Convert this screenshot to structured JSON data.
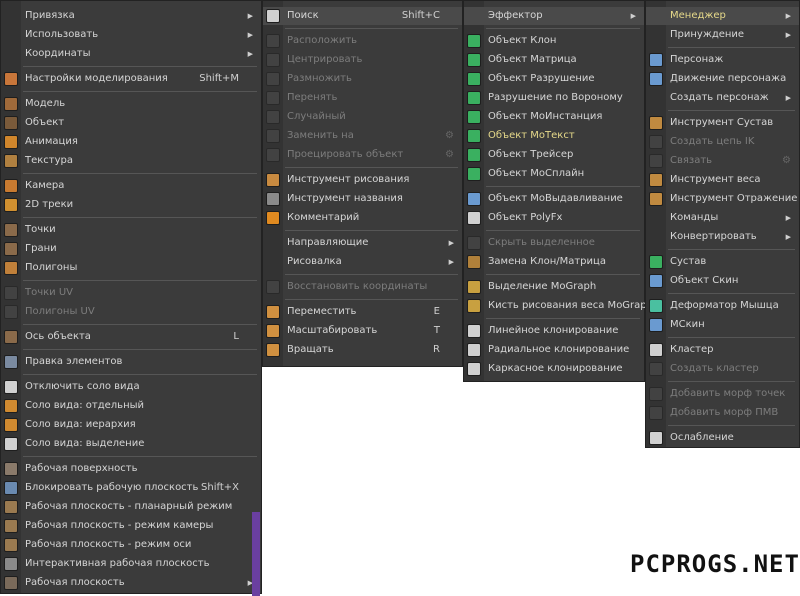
{
  "menus": {
    "main": [
      {
        "label": "Привязка",
        "arrow": true,
        "icon": "empty"
      },
      {
        "label": "Использовать",
        "arrow": true,
        "icon": "empty"
      },
      {
        "label": "Координаты",
        "arrow": true,
        "icon": "empty"
      },
      {
        "sep": true
      },
      {
        "label": "Настройки моделирования",
        "shortcut": "Shift+M",
        "icon": "modeling-settings-icon",
        "color": "#c8763a"
      },
      {
        "sep": true
      },
      {
        "label": "Модель",
        "icon": "model-icon",
        "color": "#a06a3a"
      },
      {
        "label": "Объект",
        "icon": "object-icon",
        "color": "#7a5a3a"
      },
      {
        "label": "Анимация",
        "icon": "animation-icon",
        "color": "#d0862c"
      },
      {
        "label": "Текстура",
        "icon": "texture-icon",
        "color": "#b08040"
      },
      {
        "sep": true
      },
      {
        "label": "Камера",
        "icon": "camera-icon",
        "color": "#c87a30"
      },
      {
        "label": "2D треки",
        "icon": "2d-tracks-icon",
        "color": "#d09030"
      },
      {
        "sep": true
      },
      {
        "label": "Точки",
        "icon": "points-icon",
        "color": "#8a6a4a"
      },
      {
        "label": "Грани",
        "icon": "edges-icon",
        "color": "#8a6a4a"
      },
      {
        "label": "Полигоны",
        "icon": "polygons-icon",
        "color": "#c0803a"
      },
      {
        "sep": true
      },
      {
        "label": "Точки UV",
        "disabled": true,
        "icon": "uv-points-icon",
        "color": "#555"
      },
      {
        "label": "Полигоны UV",
        "disabled": true,
        "icon": "uv-polygons-icon",
        "color": "#555"
      },
      {
        "sep": true
      },
      {
        "label": "Ось объекта",
        "shortcut": "L",
        "icon": "object-axis-icon",
        "color": "#8a6a4a"
      },
      {
        "sep": true
      },
      {
        "label": "Правка элементов",
        "icon": "edit-elements-icon",
        "color": "#7a8aa0"
      },
      {
        "sep": true
      },
      {
        "label": "Отключить соло вида",
        "icon": "solo-off-icon",
        "color": "#d0d0d0"
      },
      {
        "label": "Соло вида: отдельный",
        "icon": "solo-single-icon",
        "color": "#d08a30"
      },
      {
        "label": "Соло вида: иерархия",
        "icon": "solo-hierarchy-icon",
        "color": "#d08a30"
      },
      {
        "label": "Соло вида: выделение",
        "icon": "solo-selection-icon",
        "color": "#d0d0d0"
      },
      {
        "sep": true
      },
      {
        "label": "Рабочая поверхность",
        "icon": "workplane-icon",
        "color": "#8a7a6a"
      },
      {
        "label": "Блокировать рабочую плоскость",
        "shortcut": "Shift+X",
        "icon": "lock-workplane-icon",
        "color": "#6a8ab0"
      },
      {
        "label": "Рабочая плоскость - планарный режим",
        "icon": "workplane-planar-icon",
        "color": "#9a7a50"
      },
      {
        "label": "Рабочая плоскость - режим камеры",
        "icon": "workplane-camera-icon",
        "color": "#9a7a50"
      },
      {
        "label": "Рабочая плоскость - режим оси",
        "icon": "workplane-axis-icon",
        "color": "#9a7a50"
      },
      {
        "label": "Интерактивная рабочая плоскость",
        "icon": "interactive-workplane-icon",
        "color": "#8a8a8a"
      },
      {
        "label": "Рабочая плоскость",
        "arrow": true,
        "icon": "workplane-sub-icon",
        "color": "#7a6a5a"
      }
    ],
    "second": [
      {
        "label": "Поиск",
        "shortcut": "Shift+C",
        "icon": "search-icon",
        "color": "#d0d0d0",
        "highlight": true
      },
      {
        "sep": true
      },
      {
        "label": "Расположить",
        "disabled": true,
        "icon": "arrange-icon",
        "color": "#555"
      },
      {
        "label": "Центрировать",
        "disabled": true,
        "icon": "center-icon",
        "color": "#555"
      },
      {
        "label": "Размножить",
        "disabled": true,
        "icon": "duplicate-icon",
        "color": "#555"
      },
      {
        "label": "Перенять",
        "disabled": true,
        "icon": "transfer-icon",
        "color": "#555"
      },
      {
        "label": "Случайный",
        "disabled": true,
        "icon": "randomize-icon",
        "color": "#555"
      },
      {
        "label": "Заменить на",
        "disabled": true,
        "icon": "replace-icon",
        "color": "#555",
        "gear": true
      },
      {
        "label": "Проецировать объект",
        "disabled": true,
        "icon": "project-icon",
        "color": "#555",
        "gear": true
      },
      {
        "sep": true
      },
      {
        "label": "Инструмент рисования",
        "icon": "paint-tool-icon",
        "color": "#c88a40"
      },
      {
        "label": "Инструмент названия",
        "icon": "naming-tool-icon",
        "color": "#8a8a8a"
      },
      {
        "label": "Комментарий",
        "icon": "comment-icon",
        "color": "#e08a20"
      },
      {
        "sep": true
      },
      {
        "label": "Направляющие",
        "arrow": true,
        "icon": "empty"
      },
      {
        "label": "Рисовалка",
        "arrow": true,
        "icon": "empty"
      },
      {
        "sep": true
      },
      {
        "label": "Восстановить координаты",
        "disabled": true,
        "icon": "reset-coords-icon",
        "color": "#555"
      },
      {
        "sep": true
      },
      {
        "label": "Переместить",
        "shortcut": "E",
        "icon": "move-icon",
        "color": "#d09040"
      },
      {
        "label": "Масштабировать",
        "shortcut": "T",
        "icon": "scale-icon",
        "color": "#d09040"
      },
      {
        "label": "Вращать",
        "shortcut": "R",
        "icon": "rotate-icon",
        "color": "#d09040"
      }
    ],
    "third": [
      {
        "label": "Эффектор",
        "arrow": true,
        "icon": "empty",
        "highlight": true
      },
      {
        "sep": true
      },
      {
        "label": "Объект Клон",
        "icon": "cloner-icon",
        "color": "#3ab060"
      },
      {
        "label": "Объект Матрица",
        "icon": "matrix-icon",
        "color": "#3ab060"
      },
      {
        "label": "Объект Разрушение",
        "icon": "fracture-icon",
        "color": "#3ab060"
      },
      {
        "label": "Разрушение по Вороному",
        "icon": "voronoi-icon",
        "color": "#3ab060"
      },
      {
        "label": "Объект МоИнстанция",
        "icon": "moinstance-icon",
        "color": "#3ab060"
      },
      {
        "label": "Объект МоТекст",
        "icon": "motext-icon",
        "color": "#3ab060",
        "selected": true
      },
      {
        "label": "Объект Трейсер",
        "icon": "tracer-icon",
        "color": "#3ab060"
      },
      {
        "label": "Объект МоСплайн",
        "icon": "mospline-icon",
        "color": "#3ab060"
      },
      {
        "sep": true
      },
      {
        "label": "Объект МоВыдавливание",
        "icon": "moextrude-icon",
        "color": "#6a9ad0"
      },
      {
        "label": "Объект PolyFx",
        "icon": "polyfx-icon",
        "color": "#d0d0d0"
      },
      {
        "sep": true
      },
      {
        "label": "Скрыть выделенное",
        "disabled": true,
        "icon": "hide-selected-icon",
        "color": "#555"
      },
      {
        "label": "Замена Клон/Матрица",
        "icon": "swap-cloner-icon",
        "color": "#b0803a"
      },
      {
        "sep": true
      },
      {
        "label": "Выделение MoGraph",
        "icon": "mograph-selection-icon",
        "color": "#c8a040"
      },
      {
        "label": "Кисть рисования веса MoGraph",
        "icon": "mograph-brush-icon",
        "color": "#c8a040"
      },
      {
        "sep": true
      },
      {
        "label": "Линейное клонирование",
        "icon": "linear-clone-icon",
        "color": "#d0d0d0"
      },
      {
        "label": "Радиальное клонирование",
        "icon": "radial-clone-icon",
        "color": "#d0d0d0"
      },
      {
        "label": "Каркасное клонирование",
        "icon": "grid-clone-icon",
        "color": "#d0d0d0"
      }
    ],
    "fourth": [
      {
        "label": "Менеджер",
        "arrow": true,
        "icon": "empty",
        "highlight": true,
        "selected": true
      },
      {
        "label": "Принуждение",
        "arrow": true,
        "icon": "empty"
      },
      {
        "sep": true
      },
      {
        "label": "Персонаж",
        "icon": "character-icon",
        "color": "#6a9ad0"
      },
      {
        "label": "Движение персонажа",
        "icon": "character-motion-icon",
        "color": "#6a9ad0"
      },
      {
        "label": "Создать персонаж",
        "arrow": true,
        "icon": "empty"
      },
      {
        "sep": true
      },
      {
        "label": "Инструмент Сустав",
        "icon": "joint-tool-icon",
        "color": "#c08a40"
      },
      {
        "label": "Создать цепь IK",
        "disabled": true,
        "icon": "ik-chain-icon",
        "color": "#555"
      },
      {
        "label": "Связать",
        "disabled": true,
        "icon": "bind-icon",
        "color": "#555",
        "gear": true
      },
      {
        "label": "Инструмент веса",
        "icon": "weight-tool-icon",
        "color": "#c08a40"
      },
      {
        "label": "Инструмент Отражение",
        "icon": "mirror-tool-icon",
        "color": "#c08a40"
      },
      {
        "label": "Команды",
        "arrow": true,
        "icon": "empty"
      },
      {
        "label": "Конвертировать",
        "arrow": true,
        "icon": "empty"
      },
      {
        "sep": true
      },
      {
        "label": "Сустав",
        "icon": "joint-icon",
        "color": "#3ab060"
      },
      {
        "label": "Объект Скин",
        "icon": "skin-icon",
        "color": "#6a9ad0"
      },
      {
        "sep": true
      },
      {
        "label": "Деформатор Мышца",
        "icon": "muscle-deformer-icon",
        "color": "#4ac0a0"
      },
      {
        "label": "МСкин",
        "icon": "mskin-icon",
        "color": "#6a9ad0"
      },
      {
        "sep": true
      },
      {
        "label": "Кластер",
        "icon": "cluster-icon",
        "color": "#d0d0d0"
      },
      {
        "label": "Создать кластер",
        "disabled": true,
        "icon": "create-cluster-icon",
        "color": "#555"
      },
      {
        "sep": true
      },
      {
        "label": "Добавить морф точек",
        "disabled": true,
        "icon": "add-point-morph-icon",
        "color": "#555"
      },
      {
        "label": "Добавить морф ПМВ",
        "disabled": true,
        "icon": "add-pmv-morph-icon",
        "color": "#555"
      },
      {
        "sep": true
      },
      {
        "label": "Ослабление",
        "icon": "relax-icon",
        "color": "#d0d0d0"
      }
    ]
  },
  "watermark": "PCPROGS.NET"
}
